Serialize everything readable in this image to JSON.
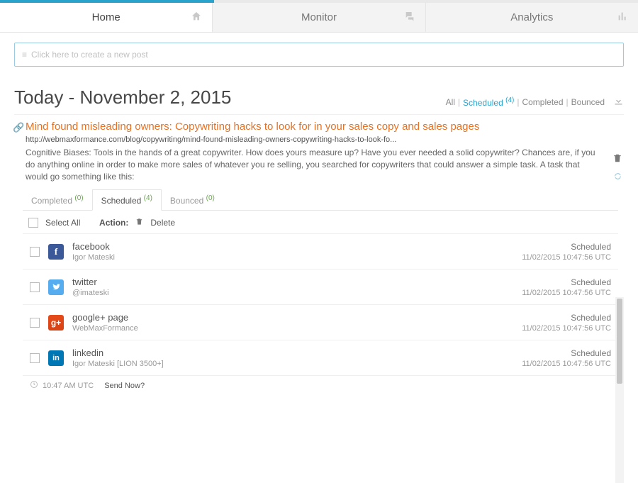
{
  "tabs": [
    {
      "label": "Home",
      "icon": "home"
    },
    {
      "label": "Monitor",
      "icon": "chat"
    },
    {
      "label": "Analytics",
      "icon": "chart"
    }
  ],
  "newPost": {
    "placeholder": "Click here to create a new post"
  },
  "dateHeading": "Today - November 2, 2015",
  "filters": {
    "all": "All",
    "scheduled": "Scheduled",
    "scheduledCount": "(4)",
    "completed": "Completed",
    "bounced": "Bounced"
  },
  "post": {
    "title": "Mind found misleading owners: Copywriting hacks to look for in your sales copy and sales pages",
    "url": "http://webmaxformance.com/blog/copywriting/mind-found-misleading-owners-copywriting-hacks-to-look-fo...",
    "excerpt": "Cognitive Biases: Tools in the hands of a great copywriter. How does yours measure up? Have you ever needed a solid copywriter? Chances are, if you do anything online in order to make more sales of whatever you re selling, you searched for copywriters that could answer a simple task. A task that would go something like this:"
  },
  "subtabs": {
    "completed": {
      "label": "Completed",
      "count": "(0)"
    },
    "scheduled": {
      "label": "Scheduled",
      "count": "(4)"
    },
    "bounced": {
      "label": "Bounced",
      "count": "(0)"
    }
  },
  "actionRow": {
    "selectAll": "Select All",
    "actionLabel": "Action:",
    "delete": "Delete"
  },
  "rows": [
    {
      "network": "facebook",
      "account": "Igor Mateski",
      "status": "Scheduled",
      "ts": "11/02/2015 10:47:56 UTC"
    },
    {
      "network": "twitter",
      "account": "@imateski",
      "status": "Scheduled",
      "ts": "11/02/2015 10:47:56 UTC"
    },
    {
      "network": "google+ page",
      "account": "WebMaxFormance",
      "status": "Scheduled",
      "ts": "11/02/2015 10:47:56 UTC"
    },
    {
      "network": "linkedin",
      "account": "Igor Mateski [LION 3500+]",
      "status": "Scheduled",
      "ts": "11/02/2015 10:47:56 UTC"
    }
  ],
  "footer": {
    "time": "10:47 AM UTC",
    "sendNow": "Send Now?"
  }
}
